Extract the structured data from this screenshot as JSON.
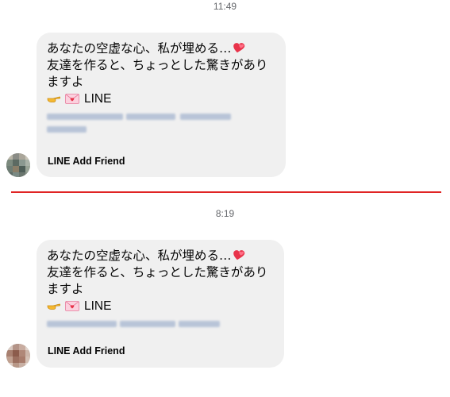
{
  "messages": [
    {
      "time": "11:49",
      "line1": "あなたの空虚な心、私が埋める…",
      "line2": "友達を作ると、ちょっとした驚きがあり",
      "line3": "ますよ",
      "line4_label": "LINE",
      "preview_title": "LINE Add Friend",
      "icons": [
        "hearts-icon",
        "pointing-hand-icon",
        "love-letter-icon"
      ]
    },
    {
      "time": "8:19",
      "line1": "あなたの空虚な心、私が埋める…",
      "line2": "友達を作ると、ちょっとした驚きがあり",
      "line3": "ますよ",
      "line4_label": "LINE",
      "preview_title": "LINE Add Friend",
      "icons": [
        "hearts-icon",
        "pointing-hand-icon",
        "love-letter-icon"
      ]
    }
  ],
  "colors": {
    "bubble_bg": "#f0f0f0",
    "divider": "#e02424",
    "timestamp": "#65676b"
  }
}
